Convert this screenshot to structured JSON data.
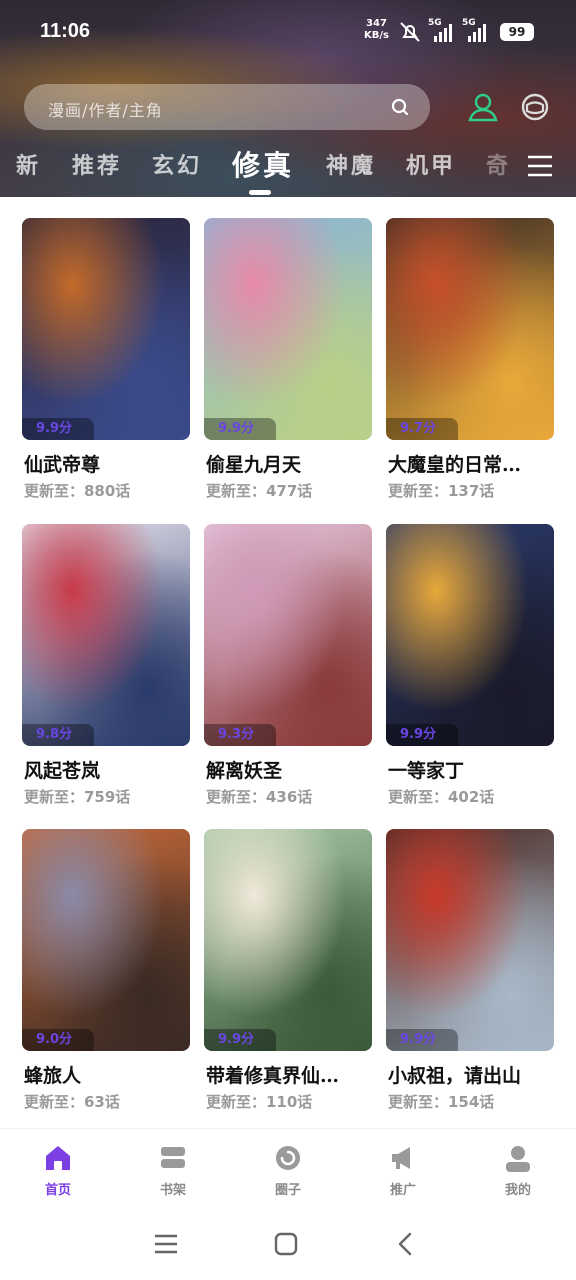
{
  "status": {
    "time": "11:06",
    "net_speed": "347",
    "net_unit": "KB/s",
    "sig1": "5G",
    "sig2": "5G",
    "battery": "99"
  },
  "search": {
    "placeholder": "漫画/作者/主角"
  },
  "tabs": [
    "新",
    "推荐",
    "玄幻",
    "修真",
    "神魔",
    "机甲",
    "奇"
  ],
  "active_tab": "修真",
  "comics": [
    {
      "title": "仙武帝尊",
      "update": "更新至：880话",
      "score": "9.9分",
      "colors": [
        "#2a2438",
        "#c46a2a",
        "#3a4a8a"
      ]
    },
    {
      "title": "偷星九月天",
      "update": "更新至：477话",
      "score": "9.9分",
      "colors": [
        "#8ab4d8",
        "#e88aa8",
        "#b8d088"
      ]
    },
    {
      "title": "大魔皇的日常…",
      "update": "更新至：137话",
      "score": "9.7分",
      "colors": [
        "#3a2a24",
        "#c8502a",
        "#e8a83a"
      ]
    },
    {
      "title": "风起苍岚",
      "update": "更新至：759话",
      "score": "9.8分",
      "colors": [
        "#e8e4ee",
        "#c83a4a",
        "#2a3a6a"
      ]
    },
    {
      "title": "解离妖圣",
      "update": "更新至：436话",
      "score": "9.3分",
      "colors": [
        "#e8c8e0",
        "#d09ab8",
        "#8a3a3a"
      ]
    },
    {
      "title": "一等家丁",
      "update": "更新至：402话",
      "score": "9.9分",
      "colors": [
        "#2a3a6a",
        "#e8a83a",
        "#1a1a2a"
      ]
    },
    {
      "title": "蜂旅人",
      "update": "更新至：63话",
      "score": "9.0分",
      "colors": [
        "#c86a3a",
        "#8a8aa8",
        "#3a2a24"
      ]
    },
    {
      "title": "带着修真界仙…",
      "update": "更新至：110话",
      "score": "9.9分",
      "colors": [
        "#a8c8a8",
        "#f0e8d8",
        "#3a5a3a"
      ]
    },
    {
      "title": "小叔祖，请出山",
      "update": "更新至：154话",
      "score": "9.9分",
      "colors": [
        "#4a2a24",
        "#c83a2a",
        "#a8b8c8"
      ]
    }
  ],
  "bottom_nav": [
    "首页",
    "书架",
    "圈子",
    "推广",
    "我的"
  ],
  "accent": "#7b3fe4",
  "score_color": "#6a46e0"
}
